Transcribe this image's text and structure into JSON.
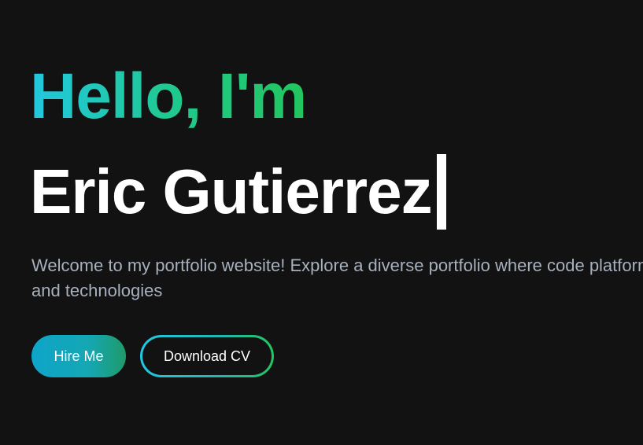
{
  "hero": {
    "greeting": "Hello, I'm",
    "name": "Eric Gutierrez",
    "description": "Welcome to my portfolio website! Explore a diverse portfolio where code platforms and technologies"
  },
  "actions": {
    "hire_label": "Hire Me",
    "download_label": "Download CV"
  },
  "colors": {
    "background": "#121212",
    "accent_start": "#22c7e0",
    "accent_end": "#22c55e",
    "text_muted": "#a7b0bd"
  }
}
